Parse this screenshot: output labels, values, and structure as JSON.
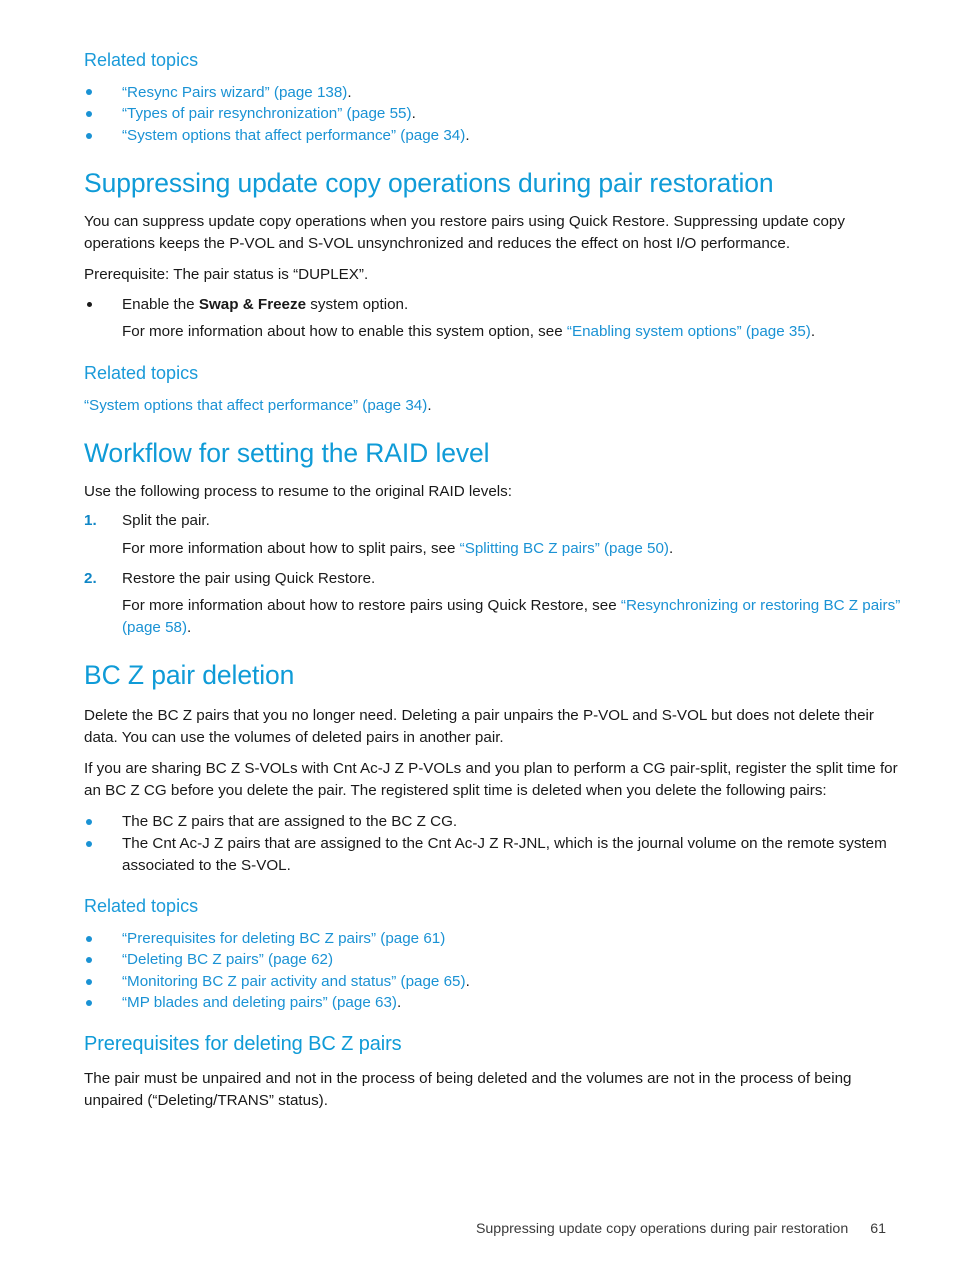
{
  "colors": {
    "heading": "#0f9bd7",
    "link": "#1a92d4",
    "bullet": "#1a92d4",
    "number": "#0f86c6",
    "body_text": "#191919",
    "footer_text": "#3b3b3b"
  },
  "related_topics_label": "Related topics",
  "block1": {
    "heading": "Related topics",
    "items": [
      {
        "link": "“Resync Pairs wizard” (page 138)",
        "tail": "."
      },
      {
        "link": "“Types of pair resynchronization” (page 55)",
        "tail": "."
      },
      {
        "link": "“System options that affect performance” (page 34)",
        "tail": "."
      }
    ]
  },
  "section_suppressing": {
    "heading": "Suppressing update copy operations during pair restoration",
    "para1": "You can suppress update copy operations when you restore pairs using Quick Restore. Suppressing update copy operations keeps the P-VOL and S-VOL unsynchronized and reduces the effect on host I/O performance.",
    "para2": "Prerequisite: The pair status is “DUPLEX”.",
    "bullet_pre": "Enable the ",
    "bullet_bold": "Swap & Freeze",
    "bullet_post": " system option.",
    "bullet_sub_pre": "For more information about how to enable this system option, see ",
    "bullet_sub_link": "“Enabling system options” (page 35)",
    "bullet_sub_tail": ".",
    "related_heading": "Related topics",
    "related_link": "“System options that affect performance” (page 34)",
    "related_tail": "."
  },
  "section_workflow": {
    "heading": "Workflow for setting the RAID level",
    "intro": "Use the following process to resume to the original RAID levels:",
    "steps": [
      {
        "num": "1.",
        "text": "Split the pair.",
        "sub_pre": "For more information about how to split pairs, see ",
        "sub_link": "“Splitting BC Z pairs” (page 50)",
        "sub_tail": "."
      },
      {
        "num": "2.",
        "text": "Restore the pair using Quick Restore.",
        "sub_pre": "For more information about how to restore pairs using Quick Restore, see ",
        "sub_link": "“Resynchronizing or restoring BC Z pairs” (page 58)",
        "sub_tail": "."
      }
    ]
  },
  "section_deletion": {
    "heading": "BC Z pair deletion",
    "para1": "Delete the BC Z pairs that you no longer need. Deleting a pair unpairs the P-VOL and S-VOL but does not delete their data. You can use the volumes of deleted pairs in another pair.",
    "para2": "If you are sharing BC Z S-VOLs with Cnt Ac-J Z P-VOLs and you plan to perform a CG pair-split, register the split time for an BC Z CG before you delete the pair. The registered split time is deleted when you delete the following pairs:",
    "bullets": [
      "The BC Z pairs that are assigned to the BC Z CG.",
      "The Cnt Ac-J Z pairs that are assigned to the Cnt Ac-J Z R-JNL, which is the journal volume on the remote system associated to the S-VOL."
    ],
    "related_heading": "Related topics",
    "related_items": [
      {
        "link": "“Prerequisites for deleting BC Z pairs” (page 61)",
        "tail": ""
      },
      {
        "link": "“Deleting BC Z pairs” (page 62)",
        "tail": ""
      },
      {
        "link": "“Monitoring BC Z pair activity and status” (page 65)",
        "tail": "."
      },
      {
        "link": "“MP blades and deleting pairs” (page 63)",
        "tail": "."
      }
    ]
  },
  "section_prereq": {
    "heading": "Prerequisites for deleting BC Z pairs",
    "para1": "The pair must be unpaired and not in the process of being deleted and the volumes are not in the process of being unpaired (“Deleting/TRANS” status)."
  },
  "footer": {
    "text": "Suppressing update copy operations during pair restoration",
    "page_number": "61"
  }
}
